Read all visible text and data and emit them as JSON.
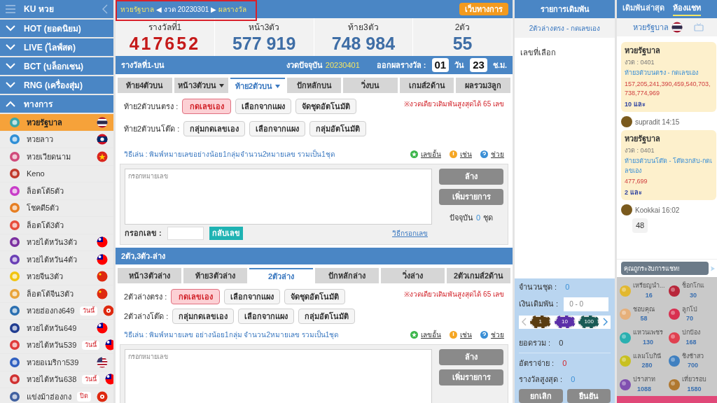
{
  "sidebar": {
    "title": "KU หวย",
    "groups": [
      {
        "label": "HOT (ยอดนิยม)",
        "expanded": false
      },
      {
        "label": "LIVE (ไลฟ์สด)",
        "expanded": false
      },
      {
        "label": "BCT (บล็อกเชน)",
        "expanded": false
      },
      {
        "label": "RNG (เครื่องสุ่ม)",
        "expanded": false
      },
      {
        "label": "ทางการ",
        "expanded": true
      }
    ],
    "items": [
      {
        "label": "หวยรัฐบาล",
        "selected": true,
        "kind": "thailand"
      },
      {
        "label": "หวยลาว",
        "selected": false,
        "kind": "laos"
      },
      {
        "label": "หวยเวียดนาม",
        "selected": false,
        "kind": "vietnam"
      },
      {
        "label": "Keno",
        "selected": false,
        "kind": "plain"
      },
      {
        "label": "ล็อตโต้5ตัว",
        "selected": false,
        "kind": "plain"
      },
      {
        "label": "โชคดี5ตัว",
        "selected": false,
        "kind": "plain"
      },
      {
        "label": "ล็อตโต้3ตัว",
        "selected": false,
        "kind": "plain"
      },
      {
        "label": "หวยไต้หวัน3ตัว",
        "selected": false,
        "kind": "taiwan"
      },
      {
        "label": "หวยไต้หวัน4ตัว",
        "selected": false,
        "kind": "taiwan"
      },
      {
        "label": "หวยจีน3ตัว",
        "selected": false,
        "kind": "china"
      },
      {
        "label": "ล็อตโต้จีน3ตัว",
        "selected": false,
        "kind": "china"
      },
      {
        "label": "หวยฮ่องกง649",
        "selected": false,
        "badge": "วันนี้",
        "kind": "hongkong"
      },
      {
        "label": "หวยไต้หวัน649",
        "selected": false,
        "kind": "taiwan"
      },
      {
        "label": "หวยไต้หวัน539",
        "selected": false,
        "badge": "วันนี้",
        "kind": "taiwan"
      },
      {
        "label": "หวยอเมริกา539",
        "selected": false,
        "kind": "usa"
      },
      {
        "label": "หวยไต้หวัน638",
        "selected": false,
        "badge": "วันนี้",
        "kind": "taiwan"
      },
      {
        "label": "แข่งม้าฮ่องกง",
        "selected": false,
        "badge": "ปิด",
        "kind": "hongkong"
      }
    ]
  },
  "header": {
    "breadcrumb": [
      "หวยรัฐบาล",
      "◀",
      "งวด 20230301",
      "▶",
      "ผลรางวัล"
    ],
    "official_button": "เว็บทางการ"
  },
  "results": [
    {
      "label": "รางวัลที่1",
      "value": "417652",
      "kind": "first"
    },
    {
      "label": "หน้า3ตัว",
      "value": "577 919",
      "kind": "other"
    },
    {
      "label": "ท้าย3ตัว",
      "value": "748 984",
      "kind": "other"
    },
    {
      "label": "2ตัว",
      "value": "55",
      "kind": "other"
    }
  ],
  "status_bar": {
    "title": "รางวัลที่1-บน",
    "round_label": "งวดปัจจุบัน",
    "round": "20230401",
    "countdown_label": "ออกผลรางวัล :",
    "days": "01",
    "days_unit": "วัน",
    "hours": "23",
    "hours_unit": "ช.ม."
  },
  "sections": [
    {
      "tabs": [
        {
          "label": "ท้าย4ตัวบน",
          "selected": false,
          "has_menu": false
        },
        {
          "label": "หน้า3ตัวบน",
          "selected": false,
          "has_menu": true
        },
        {
          "label": "ท้าย2ตัวบน",
          "selected": true,
          "has_menu": true
        },
        {
          "label": "ปักหลักบน",
          "selected": false,
          "has_menu": false
        },
        {
          "label": "วิ่งบน",
          "selected": false,
          "has_menu": false
        },
        {
          "label": "เกมส์2ด้าน",
          "selected": false,
          "has_menu": false
        },
        {
          "label": "ผลรวม3ลูก",
          "selected": false,
          "has_menu": false
        }
      ],
      "rows": [
        {
          "label": "ท้าย2ตัวบนตรง :",
          "options": [
            {
              "label": "กดเลขเอง",
              "selected": true
            },
            {
              "label": "เลือกจากแผง",
              "selected": false
            },
            {
              "label": "จัดชุดอัตโนมัติ",
              "selected": false
            }
          ]
        },
        {
          "label": "ท้าย2ตัวบนโต๊ด :",
          "options": [
            {
              "label": "กลุ่มกดเลขเอง",
              "selected": false
            },
            {
              "label": "เลือกจากแผง",
              "selected": false
            },
            {
              "label": "กลุ่มอัตโนมัติ",
              "selected": false
            }
          ]
        }
      ],
      "notice": "※งวดเดียวเดิมพันสูงสุดได้ 65 เลข",
      "help": "วิธีเล่น : พิมพ์หมายเลขอย่างน้อย1กลุ่มจำนวน2หมายเลข รวมเป็น1ชุด",
      "links": [
        {
          "label": "เลขอั้น",
          "kind": "closed"
        },
        {
          "label": "เช่น",
          "kind": "example"
        },
        {
          "label": "ช่วย",
          "kind": "help"
        }
      ],
      "entry": {
        "placeholder": "กรอกหมายเลข",
        "clear_button": "ล้าง",
        "add_button": "เพิ่มรายการ",
        "count_prefix": "ปัจจุบัน",
        "count": "0",
        "count_suffix": "ชุด",
        "input_label": "กรอกเลข :",
        "reverse_button": "กลับเลข",
        "how_link": "วิธีกรอกเลข"
      }
    },
    {
      "title": "2ตัว,3ตัว-ล่าง",
      "tabs": [
        {
          "label": "หน้า3ตัวล่าง",
          "selected": false,
          "has_menu": false
        },
        {
          "label": "ท้าย3ตัวล่าง",
          "selected": false,
          "has_menu": false
        },
        {
          "label": "2ตัวล่าง",
          "selected": true,
          "has_menu": false
        },
        {
          "label": "ปักหลักล่าง",
          "selected": false,
          "has_menu": false
        },
        {
          "label": "วิ่งล่าง",
          "selected": false,
          "has_menu": false
        },
        {
          "label": "2ตัวเกมส์2ด้าน",
          "selected": false,
          "has_menu": false
        }
      ],
      "rows": [
        {
          "label": "2ตัวล่างตรง :",
          "options": [
            {
              "label": "กดเลขเอง",
              "selected": true
            },
            {
              "label": "เลือกจากแผง",
              "selected": false
            },
            {
              "label": "จัดชุดอัตโนมัติ",
              "selected": false
            }
          ]
        },
        {
          "label": "2ตัวล่างโต๊ด :",
          "options": [
            {
              "label": "กลุ่มกดเลขเอง",
              "selected": false
            },
            {
              "label": "เลือกจากแผง",
              "selected": false
            },
            {
              "label": "กลุ่มอัตโนมัติ",
              "selected": false
            }
          ]
        }
      ],
      "notice": "※งวดเดียวเดิมพันสูงสุดได้ 65 เลข",
      "help": "วิธีเล่น : พิมพ์หมายเลข อย่างน้อย1กลุ่ม จำนวน2หมายเลข รวมเป็น1ชุด",
      "links": [
        {
          "label": "เลขอั้น",
          "kind": "closed"
        },
        {
          "label": "เช่น",
          "kind": "example"
        },
        {
          "label": "ช่วย",
          "kind": "help"
        }
      ],
      "entry": {
        "placeholder": "กรอกหมายเลข",
        "clear_button": "ล้าง",
        "add_button": "เพิ่มรายการ"
      }
    }
  ],
  "bet_slip": {
    "title": "รายการเดิมพัน",
    "bet_type": "2ตัวล่างตรง - กดเลขเอง",
    "selected_label": "เลขที่เลือก",
    "sets_label": "จำนวนชุด :",
    "sets": "0",
    "stake_label": "เงินเดิมพัน :",
    "stake_placeholder": "0 - 0",
    "chips": [
      "1",
      "10",
      "100"
    ],
    "total_label": "ยอดรวม :",
    "total": "0",
    "rate_label": "อัตราจ่าย :",
    "rate": "0",
    "max_label": "รางวัลสูงสุด :",
    "max": "0",
    "cancel_button": "ยกเลิก",
    "confirm_button": "ยืนยัน"
  },
  "chat": {
    "tabs": [
      {
        "label": "เดิมพันล่าสุด",
        "selected": false
      },
      {
        "label": "ห้องแชท",
        "selected": true
      }
    ],
    "room": "หวยรัฐบาล",
    "messages": [
      {
        "kind": "bet",
        "lottery": "หวยรัฐบาล",
        "round": "งวด : 0401",
        "bet_type": "ท้าย3ตัวบนตรง - กดเลขเอง",
        "numbers": "157,205,241,390,459,540,703, 738,774,969",
        "count": "10 และ"
      },
      {
        "kind": "bet",
        "author": "supradit 14:15",
        "lottery": "หวยรัฐบาล",
        "round": "งวด : 0401",
        "bet_type": "ท้าย3ตัวบนโต๊ด - โต๊ด3กลับ-กดเลขเอง",
        "numbers": "477,699",
        "count": "2 และ"
      },
      {
        "kind": "text",
        "author": "Kookkai 16:02",
        "text": "48"
      }
    ],
    "input_placeholder": "คุณถูกระงับการแชท!",
    "gifts": [
      {
        "name": "เหรียญนำ...",
        "price": "16"
      },
      {
        "name": "ช็อกโกแ",
        "price": "30"
      },
      {
        "name": "ชอบคุณ",
        "price": "58"
      },
      {
        "name": "ลูกโป่",
        "price": "70"
      },
      {
        "name": "แหวนเพชร",
        "price": "130"
      },
      {
        "name": "ปกป้อง",
        "price": "168"
      },
      {
        "name": "แลมโบกินี",
        "price": "280"
      },
      {
        "name": "ชิงช้าสว",
        "price": "700"
      },
      {
        "name": "ปราสาท",
        "price": "1088"
      },
      {
        "name": "เที่ยวรอบ",
        "price": "1580"
      }
    ]
  }
}
